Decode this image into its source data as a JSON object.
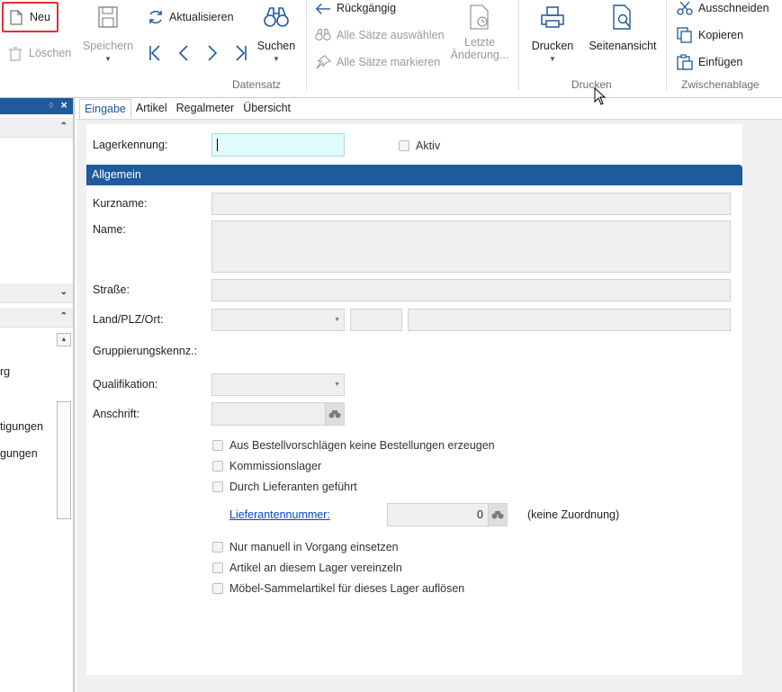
{
  "ribbon": {
    "neu": "Neu",
    "loeschen": "Löschen",
    "speichern": "Speichern",
    "aktualisieren": "Aktualisieren",
    "suchen": "Suchen",
    "rueckgaengig": "Rückgängig",
    "alle_saetze_auswaehlen": "Alle Sätze auswählen",
    "alle_saetze_markieren": "Alle Sätze markieren",
    "letzte_aenderung_1": "Letzte",
    "letzte_aenderung_2": "Änderung...",
    "drucken": "Drucken",
    "seitenansicht": "Seitenansicht",
    "ausschneiden": "Ausschneiden",
    "kopieren": "Kopieren",
    "einfuegen": "Einfügen",
    "groups": {
      "datensatz": "Datensatz",
      "drucken": "Drucken",
      "zwischenablage": "Zwischenablage"
    }
  },
  "leftpanel": {
    "items": [
      "rg",
      "tigungen",
      "gungen"
    ]
  },
  "tabs": [
    "Eingabe",
    "Artikel",
    "Regalmeter",
    "Übersicht"
  ],
  "form": {
    "lagerkennung_label": "Lagerkennung:",
    "aktiv_label": "Aktiv",
    "section_title": "Allgemein",
    "kurzname_label": "Kurzname:",
    "name_label": "Name:",
    "strasse_label": "Straße:",
    "land_plz_ort_label": "Land/PLZ/Ort:",
    "gruppierung_label": "Gruppierungskennz.:",
    "qualifikation_label": "Qualifikation:",
    "anschrift_label": "Anschrift:",
    "checkboxes_a": [
      "Aus Bestellvorschlägen keine Bestellungen erzeugen",
      "Kommissionslager",
      "Durch Lieferanten geführt"
    ],
    "lieferantennummer_link": "Lieferantennummer:",
    "lieferantennummer_value": "0",
    "keine_zuordnung": "(keine Zuordnung)",
    "checkboxes_b": [
      "Nur manuell in Vorgang einsetzen",
      "Artikel an diesem Lager vereinzeln",
      "Möbel-Sammelartikel für dieses Lager auflösen"
    ]
  },
  "colors": {
    "accent_blue": "#1e5a9c",
    "highlight_red": "#e03131",
    "active_field": "#e2fbfd",
    "link_blue": "#0b3fd6"
  }
}
